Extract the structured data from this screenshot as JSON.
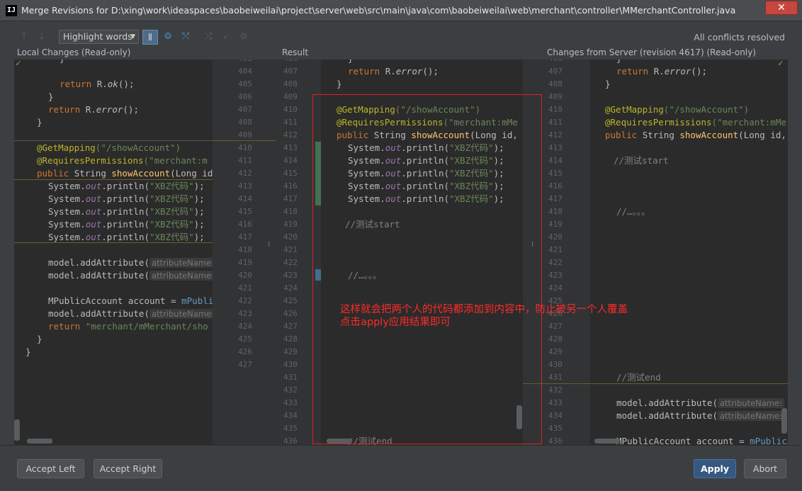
{
  "window": {
    "logo": "IJ",
    "title": "Merge Revisions for D:\\xing\\work\\ideaspaces\\baobeiweilai\\project\\server\\web\\src\\main\\java\\com\\baobeiweilai\\web\\merchant\\controller\\MMerchantController.java",
    "close": "✕"
  },
  "toolbar": {
    "highlight_label": "Highlight words",
    "status": "All conflicts resolved",
    "icons": [
      "arrow-up-icon",
      "arrow-down-icon",
      "columns-icon",
      "gear-icon",
      "magic-resolve-icon",
      "apply-left-icon",
      "apply-right-icon",
      "ignore-icon"
    ]
  },
  "panes": {
    "left_title": "Local Changes (Read-only)",
    "middle_title": "Result",
    "right_title": "Changes from Server (revision 4617) (Read-only)"
  },
  "gutter_left_numbers": [
    "403",
    "404",
    "405",
    "406",
    "407",
    "408",
    "409",
    "410",
    "411",
    "412",
    "413",
    "414",
    "415",
    "416",
    "417",
    "418",
    "419",
    "420",
    "421",
    "422",
    "423",
    "424",
    "425",
    "426",
    "427"
  ],
  "gutter_mid_numbers": [
    "406",
    "407",
    "408",
    "409",
    "410",
    "411",
    "412",
    "413",
    "414",
    "415",
    "416",
    "417",
    "418",
    "419",
    "420",
    "421",
    "422",
    "423",
    "424",
    "425",
    "426",
    "427",
    "428",
    "429",
    "430",
    "431",
    "432",
    "433",
    "434",
    "435",
    "436"
  ],
  "gutter_right_numbers": [
    "406",
    "407",
    "408",
    "409",
    "410",
    "411",
    "412",
    "413",
    "414",
    "415",
    "416",
    "417",
    "418",
    "419",
    "420",
    "421",
    "422",
    "423",
    "424",
    "425",
    "426",
    "427",
    "428",
    "429",
    "430",
    "431",
    "432",
    "433",
    "434",
    "435",
    "436"
  ],
  "code": {
    "return_ok": "return R.ok();",
    "return_error": "return R.error();",
    "get_mapping_ann": "@GetMapping",
    "get_mapping_arg": "(\"/showAccount\")",
    "requires_ann": "@RequiresPermissions",
    "requires_arg_left": "(\"merchant:m",
    "requires_arg_mid": "(\"merchant:mMe",
    "public": "public",
    "string": "String",
    "method": "showAccount",
    "args_left": "(Long id, Str",
    "args_mid": "(Long id, String",
    "println_pre": "System.",
    "println_out": "out",
    "println_post": ".println(",
    "println_str": "\"XBZ代码\"",
    "println_end": ");",
    "model_add": "model.addAttribute(",
    "attr_hint": "attributeName:",
    "attr_right_tail": "\"m",
    "account_pre": "MPublicAccount account = ",
    "account_left": "mPublic",
    "account_right": "mPublicAcc",
    "return_view": "return ",
    "return_view_str": "\"merchant/mMerchant/sho",
    "comment_start": "//测试start",
    "comment_dots": "//…。。。",
    "comment_end": "//测试end",
    "close_brace": "}"
  },
  "annotation": {
    "line1": "这样就会把两个人的代码都添加到内容中，防止被另一个人覆盖",
    "line2": "点击apply应用结果即可"
  },
  "buttons": {
    "accept_left": "Accept Left",
    "accept_right": "Accept Right",
    "apply": "Apply",
    "abort": "Abort"
  }
}
